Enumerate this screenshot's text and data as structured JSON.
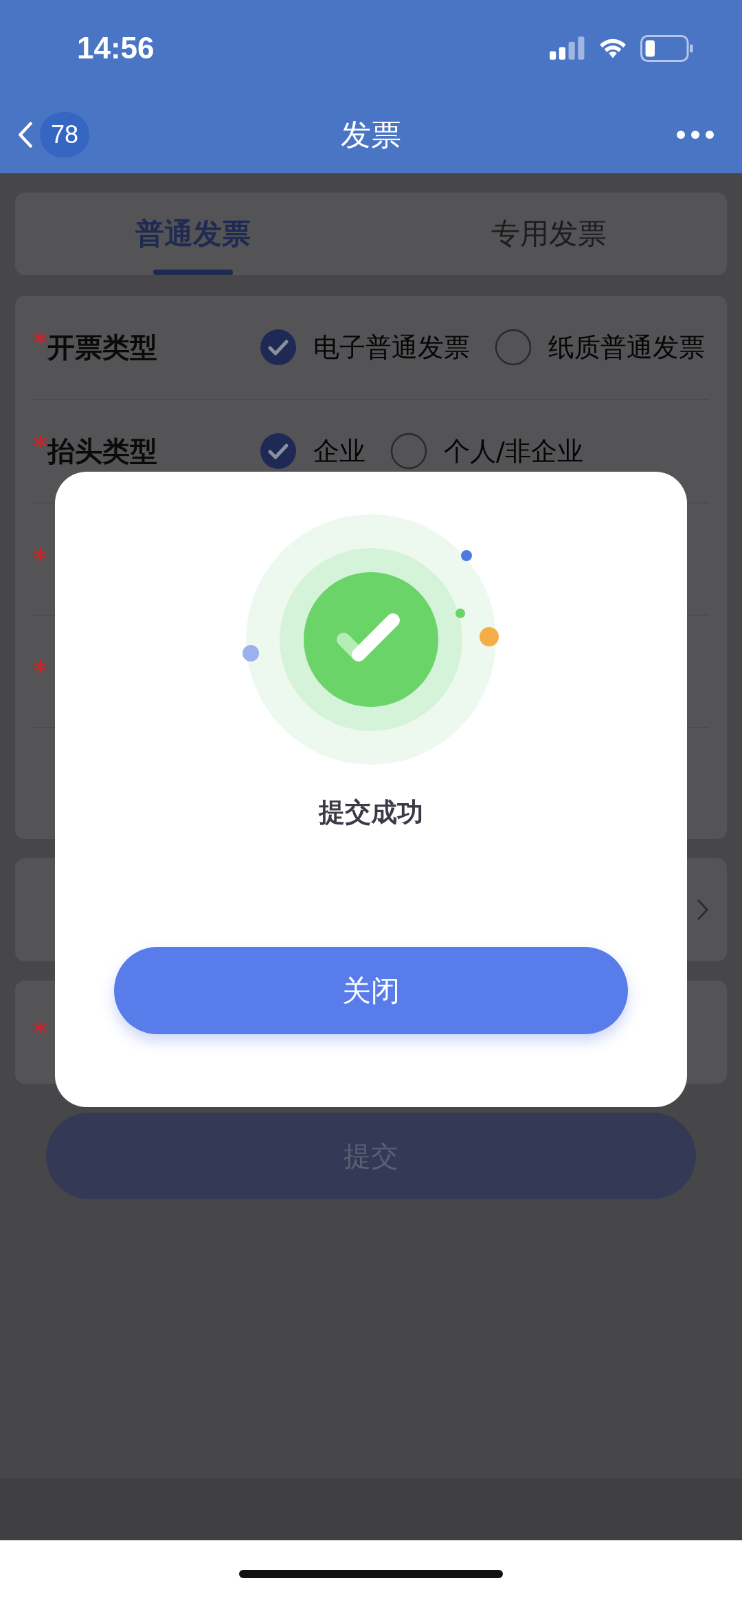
{
  "status_bar": {
    "time": "14:56"
  },
  "nav": {
    "badge": "78",
    "title": "发票"
  },
  "tabs": [
    {
      "label": "普通发票",
      "selected": true
    },
    {
      "label": "专用发票",
      "selected": false
    }
  ],
  "form": [
    {
      "kind": "choice",
      "mark": "*",
      "label": "开票类型",
      "options": [
        {
          "label": "电子普通发票",
          "selected": true
        },
        {
          "label": "纸质普通发票",
          "selected": false
        }
      ]
    },
    {
      "kind": "choice",
      "mark": "*",
      "label": "抬头类型",
      "options": [
        {
          "label": "企业",
          "selected": true
        },
        {
          "label": "个人/非企业",
          "selected": false
        }
      ]
    },
    {
      "kind": "text",
      "mark": "*"
    },
    {
      "kind": "text",
      "mark": "*"
    },
    {
      "kind": "text"
    }
  ],
  "more_row": {
    "kind": "link"
  },
  "contact_row": {
    "mark": "*"
  },
  "submit": {
    "label": "提交",
    "disabled": true
  },
  "dialog": {
    "message": "提交成功",
    "button": "关闭"
  }
}
